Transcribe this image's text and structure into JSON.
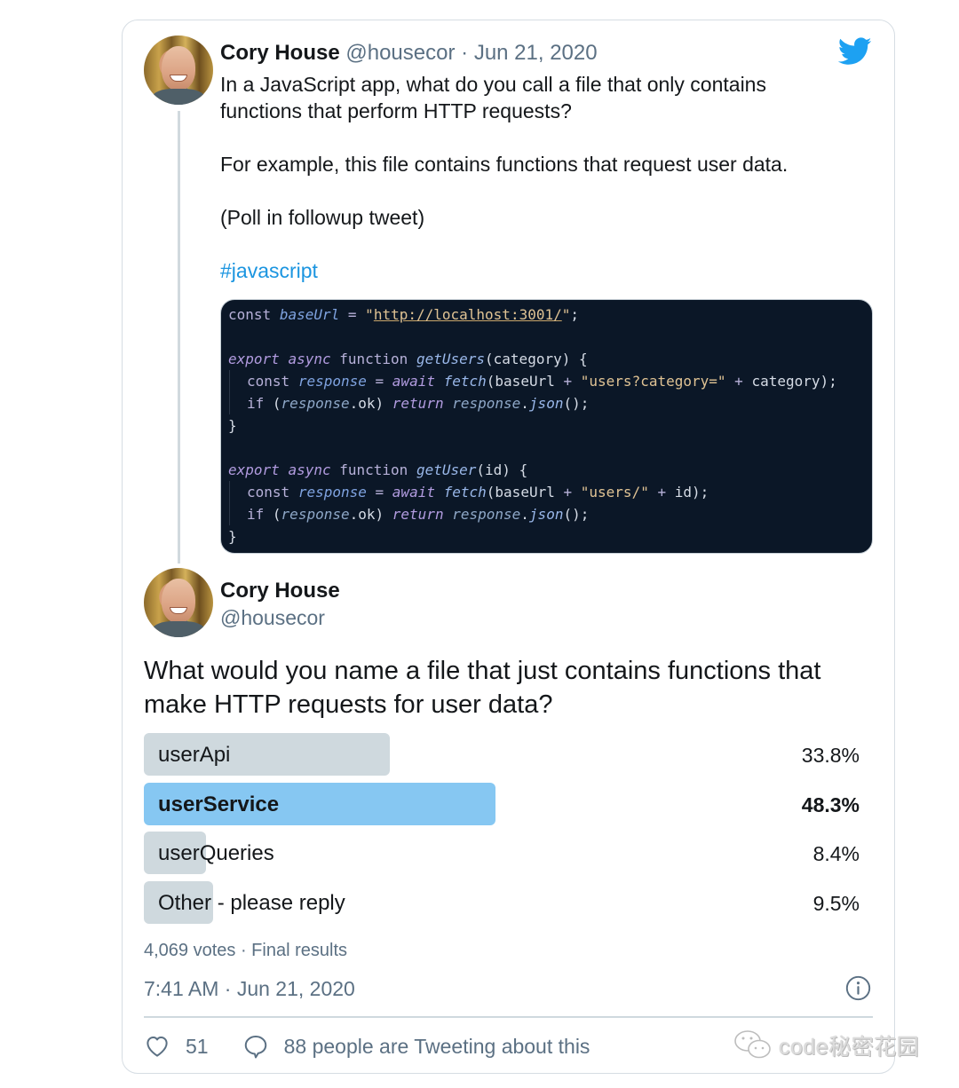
{
  "tweet1": {
    "author_name": "Cory House",
    "author_handle": "@housecor",
    "separator": "·",
    "date": "Jun 21, 2020",
    "lines": [
      "In a JavaScript app, what do you call a file that only contains",
      "functions that perform HTTP requests?",
      "For example, this file contains functions that request user data.",
      "(Poll in followup tweet)"
    ],
    "hashtag": "#javascript",
    "code_image": {
      "lines": [
        "const baseUrl = \"http://localhost:3001/\";",
        "",
        "export async function getUsers(category) {",
        "  const response = await fetch(baseUrl + \"users?category=\" + category);",
        "  if (response.ok) return response.json();",
        "}",
        "",
        "export async function getUser(id) {",
        "  const response = await fetch(baseUrl + \"users/\" + id);",
        "  if (response.ok) return response.json();",
        "}"
      ],
      "tokens": {
        "const": "const",
        "baseUrl": "baseUrl",
        "eq": "=",
        "url": "http://localhost:3001/",
        "semi": ";",
        "export": "export",
        "async": "async",
        "function": "function",
        "getUsers": "getUsers",
        "getUser": "getUser",
        "category": "category",
        "id": "id",
        "response": "response",
        "await": "await",
        "fetch": "fetch",
        "users_q": "\"users?category=\"",
        "users_slash": "\"users/\"",
        "if": "if",
        "ok": "ok",
        "return": "return",
        "json": "json",
        "plus": "+"
      }
    }
  },
  "tweet2": {
    "author_name": "Cory House",
    "author_handle": "@housecor",
    "question": "What would you name a file that just contains functions that make HTTP requests for user data?",
    "poll": {
      "options": [
        {
          "label": "userApi",
          "percent_text": "33.8%",
          "percent": 33.8,
          "winner": false
        },
        {
          "label": "userService",
          "percent_text": "48.3%",
          "percent": 48.3,
          "winner": true
        },
        {
          "label": "userQueries",
          "percent_text": "8.4%",
          "percent": 8.4,
          "winner": false
        },
        {
          "label": "Other - please reply",
          "percent_text": "9.5%",
          "percent": 9.5,
          "winner": false
        }
      ],
      "votes_summary": "4,069 votes · Final results"
    },
    "timestamp": "7:41 AM · Jun 21, 2020",
    "likes": "51",
    "conversation": "88 people are Tweeting about this"
  },
  "colors": {
    "twitter_blue": "#1da1f2",
    "link_blue": "#1b95e0",
    "winner_bar": "#86c7f2",
    "other_bar": "#cfd9de",
    "code_bg": "#0b1727"
  },
  "icons": {
    "brand": "twitter-bird-icon",
    "info": "info-icon",
    "like": "heart-icon",
    "reply": "speech-bubble-icon",
    "watermark": "wechat-icon"
  },
  "watermark": {
    "text": "code秘密花园"
  }
}
